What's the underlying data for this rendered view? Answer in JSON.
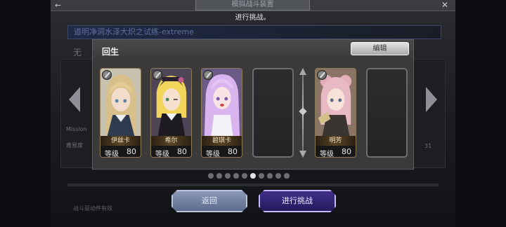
{
  "background": {
    "top_tab": "模拟战斗装置",
    "hint": "进行挑战。",
    "quest_title": "道明净洞水泽大炽之试练-extreme",
    "sub_letter": "无",
    "mission_label": "Mission",
    "hint2": "难易度",
    "num_right": "31",
    "bottom_tip": "战斗驱动件有效"
  },
  "modal": {
    "title": "回生",
    "edit_label": "编辑",
    "cards": [
      {
        "name": "伊丝卡",
        "level_label": "等级",
        "level": "80"
      },
      {
        "name": "希尔",
        "level_label": "等级",
        "level": "80"
      },
      {
        "name": "碧琪卡",
        "level_label": "等级",
        "level": "80"
      },
      {
        "name": "明芳",
        "level_label": "等级",
        "level": "80"
      }
    ],
    "page_dots": 10,
    "active_dot": 5
  },
  "buttons": {
    "back": "返回",
    "start": "进行挑战"
  },
  "colors": {
    "modal_bg": "#3a3a3a",
    "card_border": "#8b7a55",
    "start_button": "#3f2f8a",
    "back_button": "#8c9ab8"
  },
  "icons": [
    "back-arrow-icon",
    "close-icon",
    "chevron-left-icon",
    "chevron-right-icon",
    "sword-badge-icon"
  ]
}
